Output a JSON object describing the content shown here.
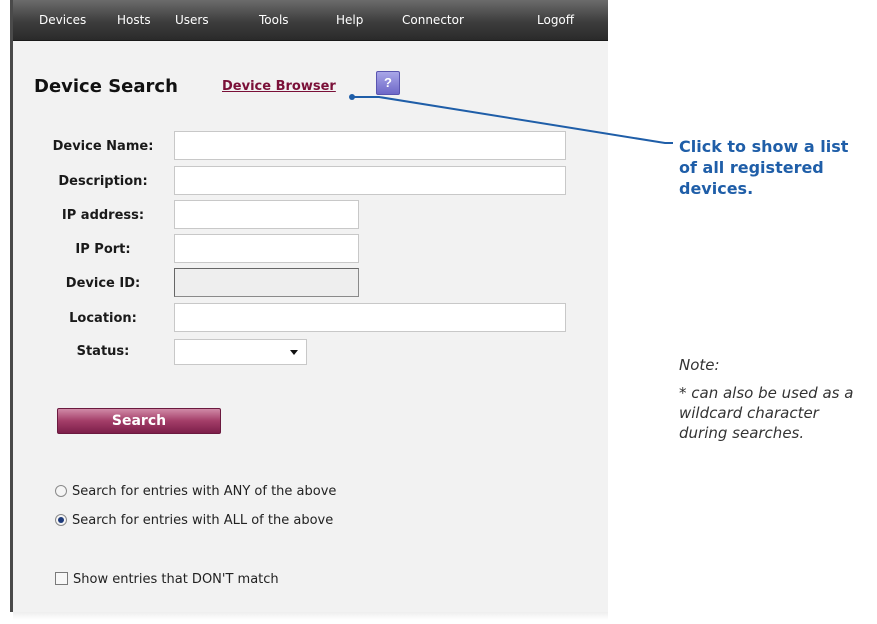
{
  "menu": {
    "items": [
      "Devices",
      "Hosts",
      "Users",
      "Tools",
      "Help",
      "Connector",
      "Logoff"
    ]
  },
  "page": {
    "title": "Device Search",
    "browser_link": "Device Browser",
    "help_label": "?"
  },
  "form": {
    "labels": {
      "device_name": "Device Name:",
      "description": "Description:",
      "ip_address": "IP address:",
      "ip_port": "IP Port:",
      "device_id": "Device ID:",
      "location": "Location:",
      "status": "Status:"
    },
    "values": {
      "device_name": "",
      "description": "",
      "ip_address": "",
      "ip_port": "",
      "device_id": "",
      "location": "",
      "status": ""
    }
  },
  "actions": {
    "search_label": "Search"
  },
  "options": {
    "any_label": "Search for entries with ANY of the above",
    "all_label": "Search for entries with ALL of the above",
    "selected": "all",
    "dont_match_label": "Show entries that DON'T match",
    "dont_match_checked": false
  },
  "annotations": {
    "callout": "Click to show a list of all registered devices.",
    "note_title": "Note:",
    "note_body": "* can also be used as a wildcard character during searches."
  },
  "colors": {
    "callout": "#1f5ea8",
    "link": "#7a1038",
    "search_button": "#a33d68"
  }
}
